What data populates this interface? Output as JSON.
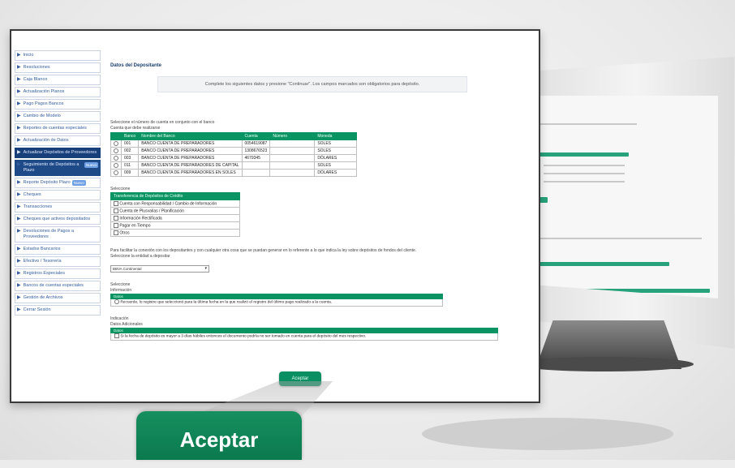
{
  "sidebar": {
    "items": [
      {
        "label": "Inicio"
      },
      {
        "label": "Resoluciones"
      },
      {
        "label": "Caja Blanco"
      },
      {
        "label": "Actualización Planos"
      },
      {
        "label": "Pago Pagos Bancos"
      },
      {
        "label": "Cambio de Modelo"
      },
      {
        "label": "Reportes de cuentas especiales"
      },
      {
        "label": "Actualización de Datos"
      },
      {
        "label": "Actualizar Depósitos de Proveedores"
      },
      {
        "label": "Seguimiento de Depósitos a Plazo",
        "badge": "Nuevo"
      },
      {
        "label": "Reporte Depósito Plazo",
        "badge": "Nuevo"
      },
      {
        "label": "Cheques"
      },
      {
        "label": "Transacciones"
      },
      {
        "label": "Cheques que activos depositados"
      },
      {
        "label": "Devoluciones de Pagos a Proveedores"
      },
      {
        "label": "Estados Bancarios"
      },
      {
        "label": "Efectivo / Tesorería"
      },
      {
        "label": "Registros Especiales"
      },
      {
        "label": "Bancos de cuentas especiales"
      },
      {
        "label": "Gestión de Archivos"
      },
      {
        "label": "Cerrar Sesión"
      }
    ]
  },
  "main": {
    "title": "Datos del Depositante",
    "notice": "Complete los siguientes datos y presione \"Continuar\". Los campos marcados son obligatorios para depósito.",
    "table_intro": "Seleccione el número de cuenta en conjunto con el banco",
    "table_intro2": "Cuenta que debe realizarse",
    "table": {
      "headers": [
        "",
        "Banco",
        "Nombre del Banco",
        "Cuenta",
        "Número",
        "Moneda"
      ],
      "rows": [
        [
          "001",
          "BANCO CUENTA DE PREPARADORES",
          "0054619087",
          "",
          "SOLES"
        ],
        [
          "002",
          "BANCO CUENTA DE PREPARADORES",
          "1308676523",
          "",
          "SOLES"
        ],
        [
          "003",
          "BANCO CUENTA DE PREPARADORES",
          "4679345",
          "",
          "DÓLARES"
        ],
        [
          "011",
          "BANCO CUENTA DE PREPARADORES DE CAPITAL",
          "",
          "",
          "SOLES"
        ],
        [
          "009",
          "BANCO CUENTA DE PREPARADORES EN SOLES",
          "",
          "",
          "DÓLARES"
        ]
      ]
    },
    "section2_label": "Seleccione",
    "options_header": "Transferencia de Depósitos de Crédito",
    "options": [
      "Cuenta con Responsabilidad / Cambio de Información",
      "Cuenta de Plusvalías / Planificación",
      "Información Rectificada",
      "Pagar en Tiempo",
      "Otros"
    ],
    "paragraph": "Para facilitar la conexión con los depositantes y con cualquier otra cosa que se puedan generar en lo referente a lo que indica la ley sobre depósitos de fondos del cliente.",
    "dropdown_label": "Seleccione la entidad a depositar",
    "dropdown_value": "BBVA Continental",
    "section3_label": "Seleccione",
    "section3_sub": "Información",
    "bar1": "Datos",
    "bar1_row": "Recuerde, lo registre que seleccionó para la última fecha en la que realizó el registro del último pago realizado a la cuenta.",
    "section4_label": "Indicación",
    "section4_sub": "Datos Adicionales",
    "bar2": "Datos",
    "bar2_row": "Si la fecha de depósito es mayor a 3 días hábiles entonces el documento podría no ser tomado en cuenta para el depósito del mes respectivo.",
    "small_button": "Aceptar"
  },
  "big_button": "Aceptar"
}
